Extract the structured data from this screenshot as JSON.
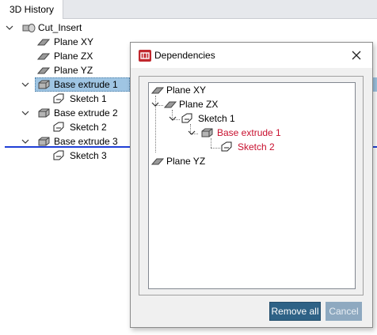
{
  "panel": {
    "tab_label": "3D History"
  },
  "tree": {
    "root": {
      "label": "Cut_Insert",
      "icon": "part-icon"
    },
    "items": [
      {
        "label": "Plane XY",
        "icon": "plane-icon"
      },
      {
        "label": "Plane ZX",
        "icon": "plane-icon"
      },
      {
        "label": "Plane YZ",
        "icon": "plane-icon"
      },
      {
        "label": "Base extrude 1",
        "icon": "extrude-icon",
        "selected": true
      },
      {
        "label": "Sketch 1",
        "icon": "sketch-icon"
      },
      {
        "label": "Base extrude 2",
        "icon": "extrude-icon"
      },
      {
        "label": "Sketch 2",
        "icon": "sketch-icon"
      },
      {
        "label": "Base extrude 3",
        "icon": "extrude-icon"
      },
      {
        "label": "Sketch 3",
        "icon": "sketch-icon"
      }
    ]
  },
  "dialog": {
    "title": "Dependencies",
    "close_icon": "close-icon",
    "tree": [
      {
        "label": "Plane XY",
        "icon": "plane-icon",
        "highlight": false
      },
      {
        "label": "Plane ZX",
        "icon": "plane-icon",
        "highlight": false
      },
      {
        "label": "Sketch 1",
        "icon": "sketch-icon",
        "highlight": false
      },
      {
        "label": "Base extrude 1",
        "icon": "extrude-icon",
        "highlight": true
      },
      {
        "label": "Sketch 2",
        "icon": "sketch-icon",
        "highlight": true
      },
      {
        "label": "Plane YZ",
        "icon": "plane-icon",
        "highlight": false
      }
    ],
    "buttons": {
      "remove_all": "Remove all",
      "cancel": "Cancel"
    }
  },
  "colors": {
    "selection": "#9fc5e3",
    "drop_line": "#1f3fd6",
    "dependency_red": "#c8102e",
    "primary_button": "#2e6286"
  }
}
